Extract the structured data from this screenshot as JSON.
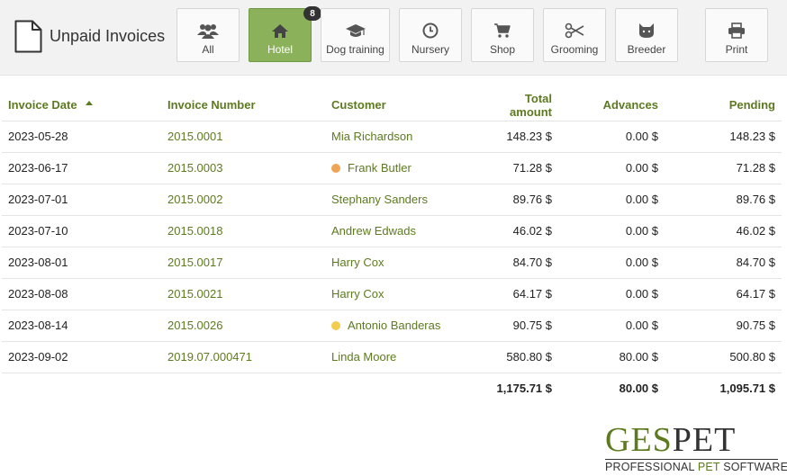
{
  "header": {
    "title": "Unpaid Invoices",
    "categories": [
      {
        "label": "All",
        "icon": "users-icon"
      },
      {
        "label": "Hotel",
        "icon": "home-icon",
        "badge": "8"
      },
      {
        "label": "Dog training",
        "icon": "graduation-cap-icon"
      },
      {
        "label": "Nursery",
        "icon": "clock-icon"
      },
      {
        "label": "Shop",
        "icon": "cart-icon"
      },
      {
        "label": "Grooming",
        "icon": "scissors-icon"
      },
      {
        "label": "Breeder",
        "icon": "cat-icon"
      },
      {
        "label": "Print",
        "icon": "printer-icon"
      }
    ],
    "active_category": "Hotel"
  },
  "table": {
    "columns": [
      "Invoice Date",
      "Invoice Number",
      "Customer",
      "Total amount",
      "Advances",
      "Pending"
    ],
    "sorted_by": "Invoice Date",
    "rows": [
      {
        "date": "2023-05-28",
        "number": "2015.0001",
        "customer": "Mia Richardson",
        "total": "148.23 $",
        "advances": "0.00 $",
        "pending": "148.23 $",
        "dot": ""
      },
      {
        "date": "2023-06-17",
        "number": "2015.0003",
        "customer": "Frank Butler",
        "total": "71.28 $",
        "advances": "0.00 $",
        "pending": "71.28 $",
        "dot": "#f0a455"
      },
      {
        "date": "2023-07-01",
        "number": "2015.0002",
        "customer": "Stephany Sanders",
        "total": "89.76 $",
        "advances": "0.00 $",
        "pending": "89.76 $",
        "dot": ""
      },
      {
        "date": "2023-07-10",
        "number": "2015.0018",
        "customer": "Andrew Edwads",
        "total": "46.02 $",
        "advances": "0.00 $",
        "pending": "46.02 $",
        "dot": ""
      },
      {
        "date": "2023-08-01",
        "number": "2015.0017",
        "customer": "Harry Cox",
        "total": "84.70 $",
        "advances": "0.00 $",
        "pending": "84.70 $",
        "dot": ""
      },
      {
        "date": "2023-08-08",
        "number": "2015.0021",
        "customer": "Harry Cox",
        "total": "64.17 $",
        "advances": "0.00 $",
        "pending": "64.17 $",
        "dot": ""
      },
      {
        "date": "2023-08-14",
        "number": "2015.0026",
        "customer": "Antonio Banderas",
        "total": "90.75 $",
        "advances": "0.00 $",
        "pending": "90.75 $",
        "dot": "#f2cc4f"
      },
      {
        "date": "2023-09-02",
        "number": "2019.07.000471",
        "customer": "Linda Moore",
        "total": "580.80 $",
        "advances": "80.00 $",
        "pending": "500.80 $",
        "dot": ""
      }
    ],
    "totals": {
      "total": "1,175.71 $",
      "advances": "80.00 $",
      "pending": "1,095.71 $"
    }
  },
  "logo": {
    "part1": "GES",
    "part2": "PET",
    "tagline_a": "PROFESSIONAL ",
    "tagline_b": "PET",
    "tagline_c": " SOFTWARE"
  },
  "colors": {
    "accent": "#5d7a1f",
    "active_button": "#8bb25a"
  }
}
